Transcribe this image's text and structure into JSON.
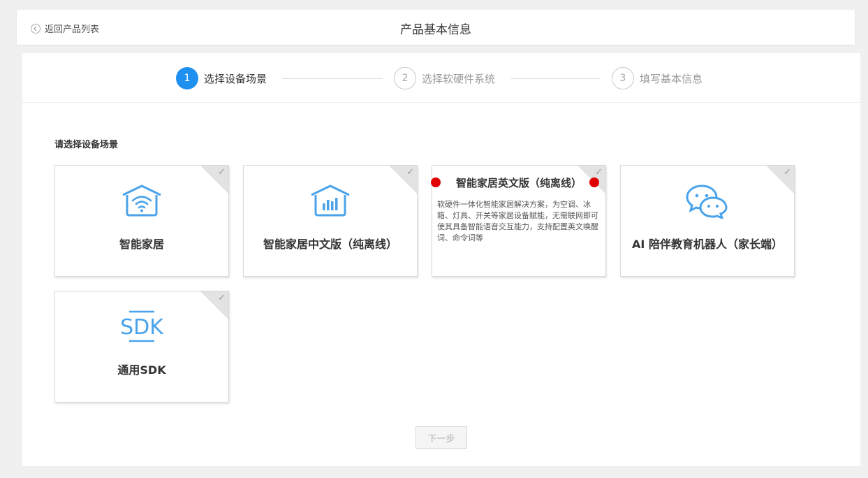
{
  "header": {
    "back_label": "返回产品列表",
    "title": "产品基本信息"
  },
  "steps": [
    {
      "num": "1",
      "label": "选择设备场景",
      "state": "active"
    },
    {
      "num": "2",
      "label": "选择软硬件系统",
      "state": "todo"
    },
    {
      "num": "3",
      "label": "填写基本信息",
      "state": "todo"
    }
  ],
  "section_label": "请选择设备场景",
  "cards": [
    {
      "title": "智能家居",
      "icon": "wifi-home-icon"
    },
    {
      "title": "智能家居中文版（纯离线）",
      "icon": "chart-home-icon"
    },
    {
      "title": "智能家居英文版（纯离线）",
      "description": "软硬件一体化智能家居解决方案，为空调、冰箱、灯具、开关等家居设备赋能，无需联网即可使其具备智能语音交互能力，支持配置英文唤醒词、命令词等",
      "expanded": true
    },
    {
      "title": "AI 陪伴教育机器人（家长端）",
      "icon": "chat-bubbles-icon"
    },
    {
      "title": "通用SDK",
      "icon": "sdk-icon",
      "icon_text": "SDK"
    }
  ],
  "next_label": "下一步",
  "colors": {
    "accent": "#1e90f0",
    "icon_blue": "#4aa3ea",
    "marker_red": "#e00000"
  }
}
